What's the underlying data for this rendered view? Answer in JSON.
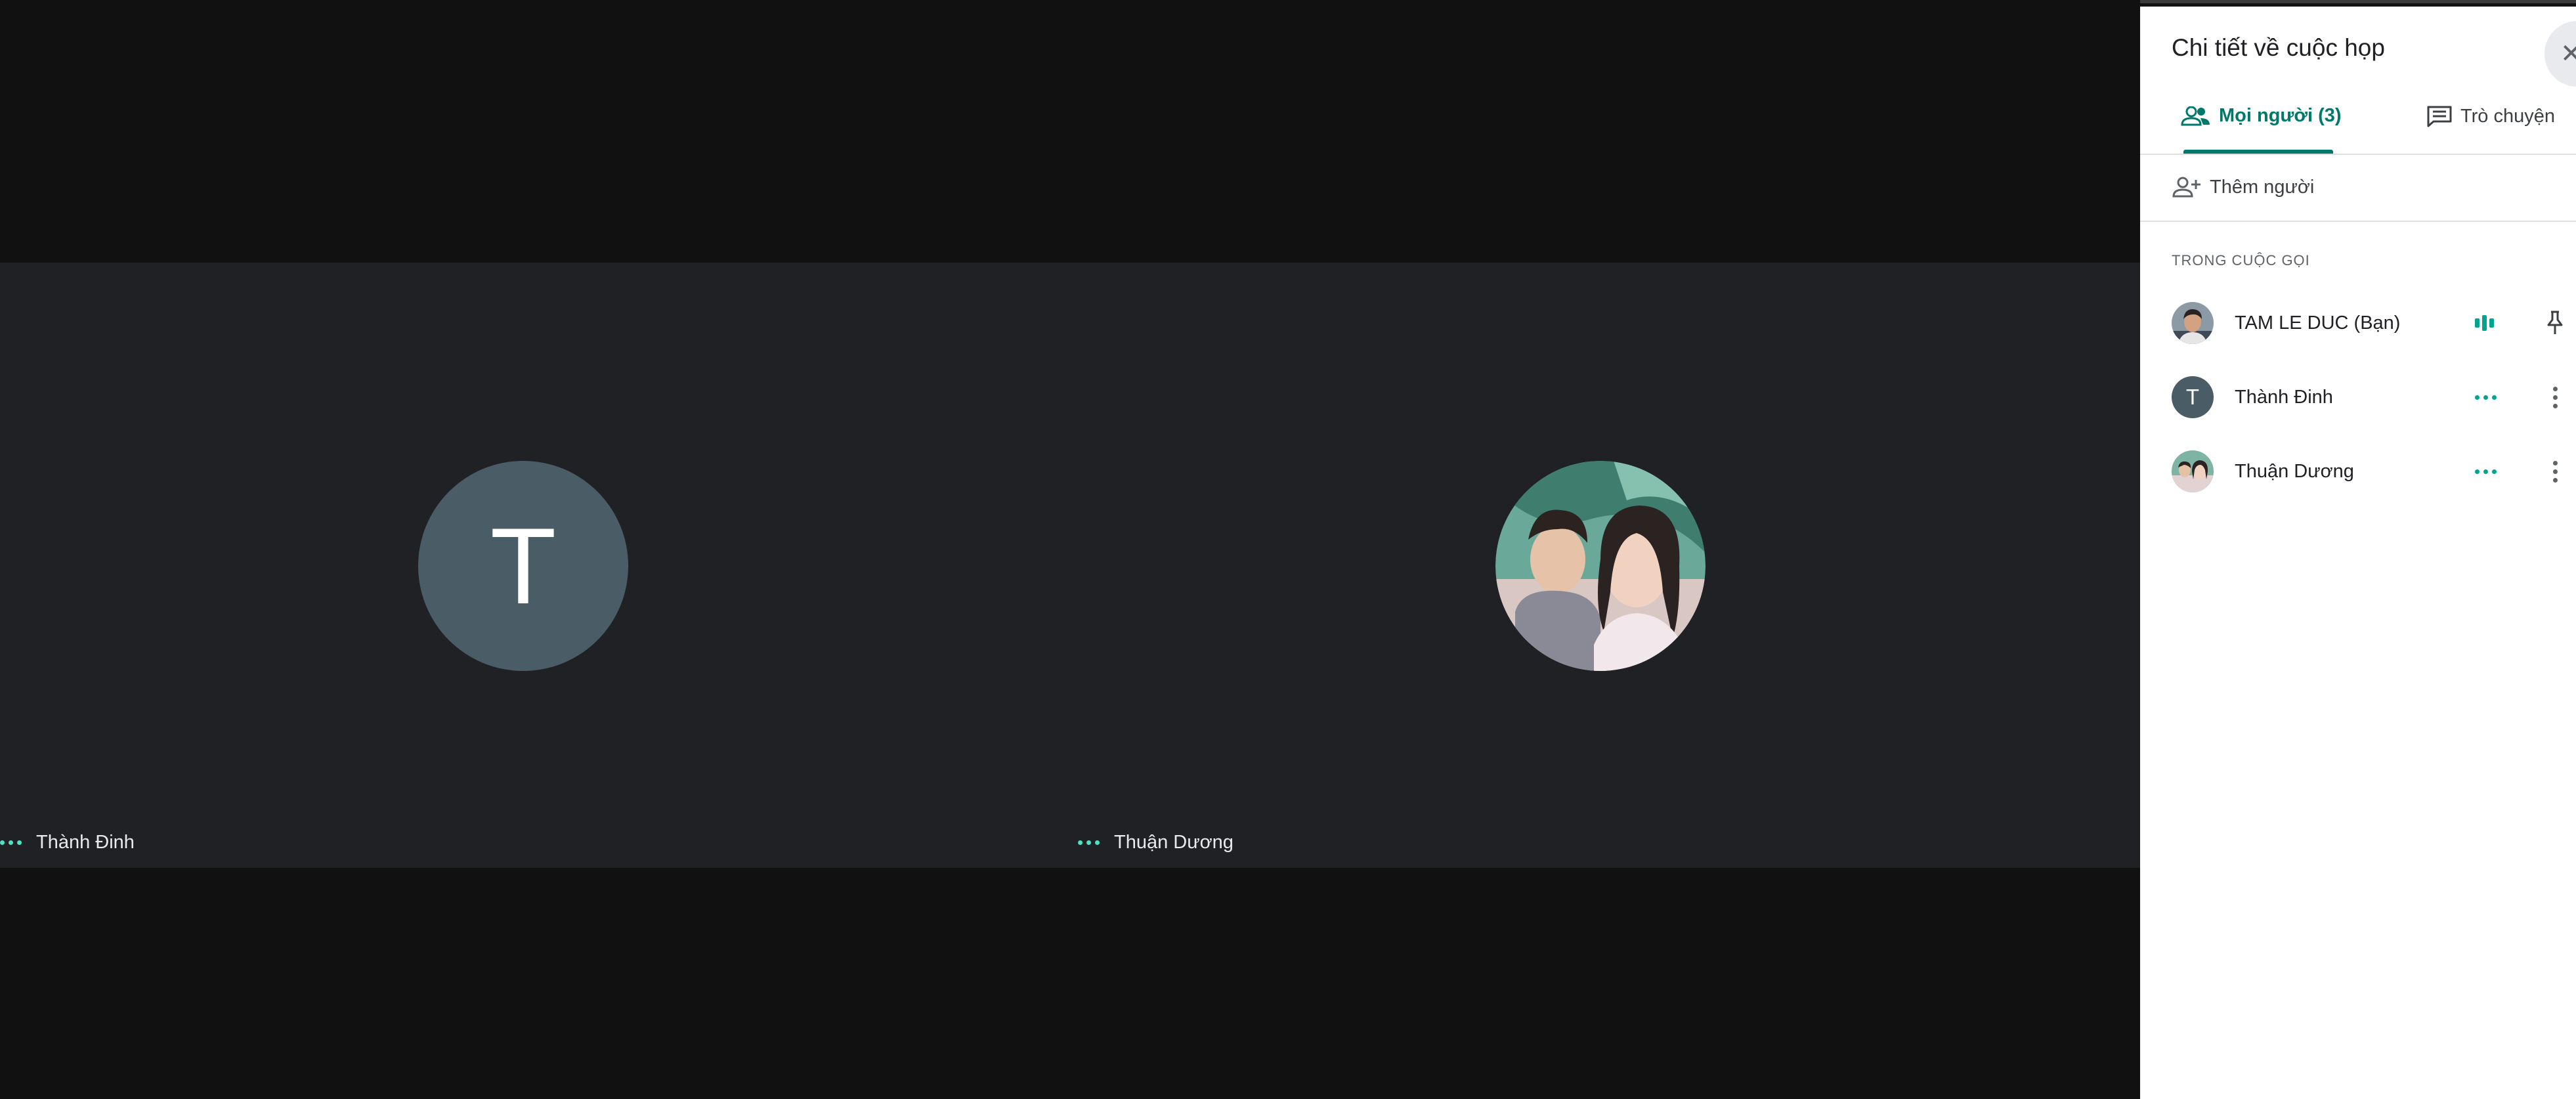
{
  "stage": {
    "tiles": [
      {
        "initial": "T",
        "name": "Thành Đinh",
        "status_icon": "speaking-dots-icon"
      },
      {
        "name": "Thuận Dương",
        "status_icon": "speaking-dots-icon",
        "avatar": "couple-photo"
      }
    ]
  },
  "panel": {
    "title": "Chi tiết về cuộc họp",
    "close_icon": "close-icon",
    "tabs": [
      {
        "label": "Mọi người (3)",
        "icon": "people-icon",
        "active": true
      },
      {
        "label": "Trò chuyện",
        "icon": "chat-icon",
        "active": false
      }
    ],
    "add_people_label": "Thêm người",
    "section_label": "TRONG CUỘC GỌI",
    "participants": [
      {
        "name": "TAM LE DUC (Bạn)",
        "status_icon": "audio-level-icon",
        "action_icon": "pin-icon"
      },
      {
        "name": "Thành Đinh",
        "initial": "T",
        "status_icon": "speaking-dots-icon",
        "action_icon": "more-vert-icon"
      },
      {
        "name": "Thuận Dương",
        "status_icon": "speaking-dots-icon",
        "action_icon": "more-vert-icon"
      }
    ]
  },
  "colors": {
    "accent": "#00796b",
    "speaking": "#4ee1c5",
    "tile_bg": "#202124",
    "page_bg": "#111111",
    "avatar_bg": "#4a5c66"
  }
}
